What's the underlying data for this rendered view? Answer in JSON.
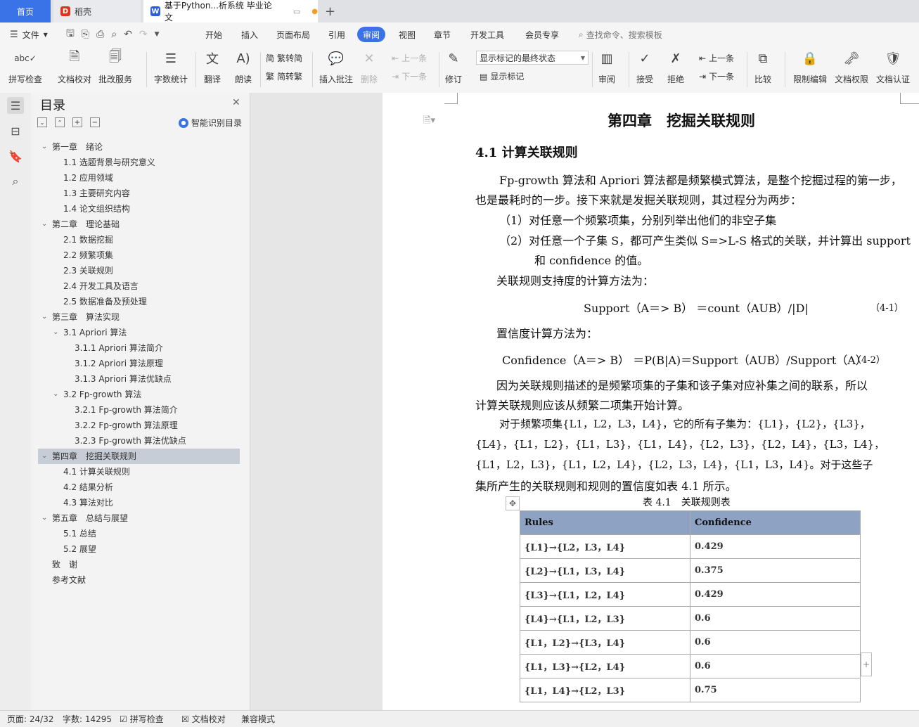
{
  "tabs": {
    "home": "首页",
    "daoke": "稻壳",
    "doc": "基于Python...析系统 毕业论文",
    "add": "+"
  },
  "menubar": {
    "file": "文件",
    "items": [
      "开始",
      "插入",
      "页面布局",
      "引用",
      "审阅",
      "视图",
      "章节",
      "开发工具",
      "会员专享"
    ],
    "active": "审阅",
    "search": "查找命令、搜索模板"
  },
  "ribbon": {
    "spell": "拼写检查",
    "proof": "文档校对",
    "batch": "批改服务",
    "wordcount": "字数统计",
    "translate": "翻译",
    "read": "朗读",
    "trad2simp": "繁转简",
    "simp2trad": "简转繁",
    "insert_comment": "插入批注",
    "delete": "删除",
    "prev": "上一条",
    "next": "下一条",
    "revise": "修订",
    "markup_select": "显示标记的最终状态",
    "show_markup": "显示标记",
    "review": "审阅",
    "accept": "接受",
    "reject": "拒绝",
    "prev2": "上一条",
    "next2": "下一条",
    "compare": "比较",
    "restrict": "限制编辑",
    "permission": "文档权限",
    "cert": "文档认证"
  },
  "toc": {
    "title": "目录",
    "smart": "智能识别目录",
    "items": [
      {
        "text": "第一章　绪论",
        "level": 1,
        "arrow": true
      },
      {
        "text": "1.1  选题背景与研究意义",
        "level": 2
      },
      {
        "text": "1.2  应用领域",
        "level": 2
      },
      {
        "text": "1.3  主要研究内容",
        "level": 2
      },
      {
        "text": "1.4  论文组织结构",
        "level": 2
      },
      {
        "text": "第二章　理论基础",
        "level": 1,
        "arrow": true
      },
      {
        "text": "2.1  数据挖掘",
        "level": 2
      },
      {
        "text": "2.2  频繁项集",
        "level": 2
      },
      {
        "text": "2.3  关联规则",
        "level": 2
      },
      {
        "text": "2.4  开发工具及语言",
        "level": 2
      },
      {
        "text": "2.5  数据准备及预处理",
        "level": 2
      },
      {
        "text": "第三章　算法实现",
        "level": 1,
        "arrow": true
      },
      {
        "text": "3.1 Apriori 算法",
        "level": 2,
        "arrow": true
      },
      {
        "text": "3.1.1 Apriori 算法简介",
        "level": 3
      },
      {
        "text": "3.1.2 Apriori 算法原理",
        "level": 3
      },
      {
        "text": "3.1.3 Apriori 算法优缺点",
        "level": 3
      },
      {
        "text": "3.2 Fp-growth 算法",
        "level": 2,
        "arrow": true
      },
      {
        "text": "3.2.1 Fp-growth 算法简介",
        "level": 3
      },
      {
        "text": "3.2.2 Fp-growth 算法原理",
        "level": 3
      },
      {
        "text": "3.2.3 Fp-growth 算法优缺点",
        "level": 3
      },
      {
        "text": "第四章　挖掘关联规则",
        "level": 1,
        "arrow": true,
        "selected": true
      },
      {
        "text": "4.1  计算关联规则",
        "level": 2
      },
      {
        "text": "4.2  结果分析",
        "level": 2
      },
      {
        "text": "4.3  算法对比",
        "level": 2
      },
      {
        "text": "第五章　总结与展望",
        "level": 1,
        "arrow": true
      },
      {
        "text": "5.1  总结",
        "level": 2
      },
      {
        "text": "5.2  展望",
        "level": 2
      },
      {
        "text": "致　谢",
        "level": 1
      },
      {
        "text": "参考文献",
        "level": 1
      }
    ]
  },
  "doc": {
    "chapter": "第四章　挖掘关联规则",
    "section": "4.1  计算关联规则",
    "p1a": "Fp-growth 算法和 Apriori 算法都是频繁模式算法，是整个挖掘过程的第一步，",
    "p1b": "也是最耗时的一步。接下来就是发掘关联规则，其过程分为两步：",
    "step1": "（1）对任意一个频繁项集，分别列举出他们的非空子集",
    "step2a": "（2）对任意一个子集 S，都可产生类似 S=>L-S 格式的关联，并计算出 support",
    "step2b": "和 confidence 的值。",
    "support_intro": "关联规则支持度的计算方法为：",
    "formula1": "Support（A＝> B） ＝count（AUB）/|D|",
    "formula1_no": "（4-1）",
    "conf_intro": "置信度计算方法为：",
    "formula2": "Confidence（A＝> B） ＝P(B|A)＝Support（AUB）/Support（A）",
    "formula2_no": "（4-2）",
    "p2a": "因为关联规则描述的是频繁项集的子集和该子集对应补集之间的联系，所以",
    "p2b": "计算关联规则应该从频繁二项集开始计算。",
    "p3a": "对于频繁项集{L1，L2，L3，L4}，它的所有子集为：{L1}，{L2}，{L3}，",
    "p3b": "{L4}，{L1，L2}，{L1，L3}，{L1，L4}，{L2，L3}，{L2，L4}，{L3，L4}，",
    "p3c": "{L1，L2，L3}，{L1，L2，L4}，{L2，L3，L4}，{L1，L3，L4}。对于这些子",
    "p3d": "集所产生的关联规则和规则的置信度如表 4.1 所示。",
    "table_caption": "表 4.1　关联规则表",
    "table_headers": [
      "Rules",
      "Confidence"
    ],
    "table_rows": [
      [
        "{L1}→{L2，L3，L4}",
        "0.429"
      ],
      [
        "{L2}→{L1，L3，L4}",
        "0.375"
      ],
      [
        "{L3}→{L1，L2，L4}",
        "0.429"
      ],
      [
        "{L4}→{L1，L2，L3}",
        "0.6"
      ],
      [
        "{L1，L2}→{L3，L4}",
        "0.6"
      ],
      [
        "{L1，L3}→{L2，L4}",
        "0.6"
      ],
      [
        "{L1，L4}→{L2，L3}",
        "0.75"
      ]
    ]
  },
  "status": {
    "page": "页面: 24/32",
    "words": "字数: 14295",
    "spell": "拼写检查",
    "proof": "文档校对",
    "compat": "兼容模式"
  },
  "colors": {
    "accent": "#3a73e8",
    "table_header": "#8ea3c4"
  }
}
